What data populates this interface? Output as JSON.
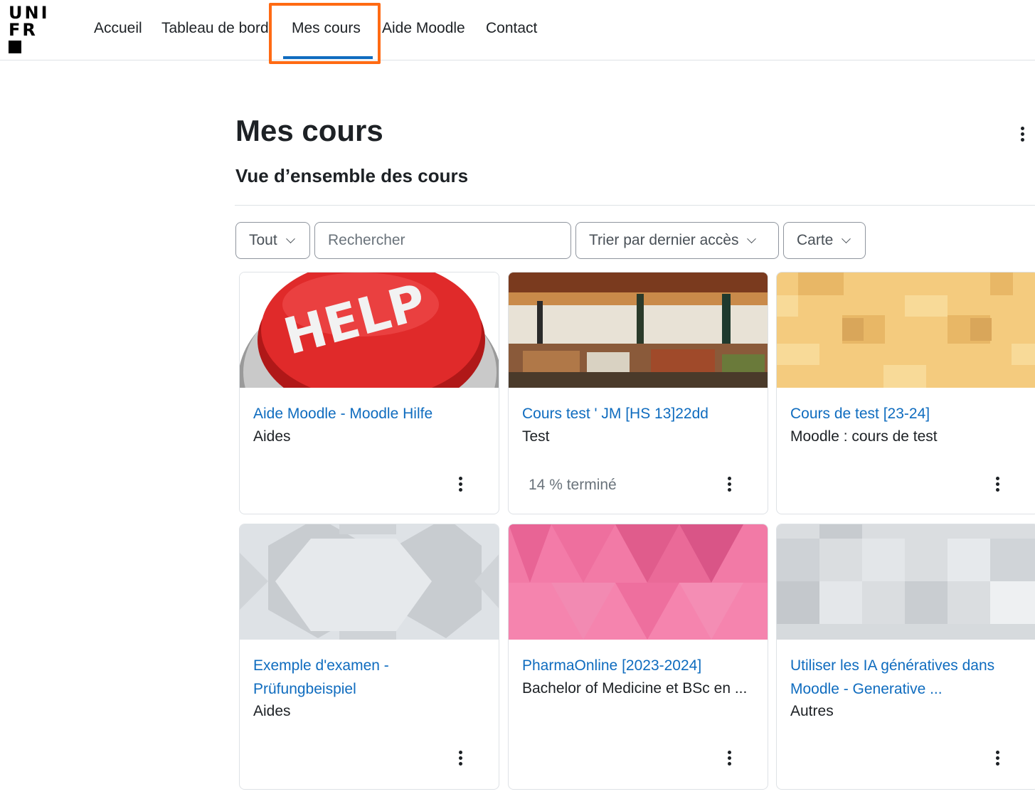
{
  "logo": {
    "line1": "UNI",
    "line2": "FR"
  },
  "nav": {
    "items": [
      "Accueil",
      "Tableau de bord",
      "Mes cours",
      "Aide Moodle",
      "Contact"
    ],
    "active": "Mes cours"
  },
  "page": {
    "title": "Mes cours",
    "section_title": "Vue d’ensemble des cours"
  },
  "filters": {
    "grouping": "Tout",
    "search_placeholder": "Rechercher",
    "sort": "Trier par dernier accès",
    "view": "Carte"
  },
  "courses": [
    {
      "title": "Aide Moodle - Moodle Hilfe",
      "category": "Aides",
      "progress": "",
      "image": "help-button-photo"
    },
    {
      "title": "Cours test ' JM [HS 13]22dd",
      "category": "Test",
      "progress": "14 % terminé",
      "image": "market-photo"
    },
    {
      "title": "Cours de test [23-24]",
      "category": "Moodle : cours de test",
      "progress": "",
      "image": "yellow-pattern"
    },
    {
      "title_line1": "Exemple d'examen -",
      "title_line2": "Prüfungbeispiel",
      "category": "Aides",
      "progress": "",
      "image": "grey-octagon-pattern"
    },
    {
      "title": "PharmaOnline [2023-2024]",
      "category": "Bachelor of Medicine et BSc en ...",
      "progress": "",
      "image": "pink-triangle-pattern"
    },
    {
      "title_line1": "Utiliser les IA génératives dans",
      "title_line2": "Moodle - Generative ...",
      "category": "Autres",
      "progress": "",
      "image": "grey-square-pattern"
    }
  ],
  "colors": {
    "link": "#0f6cbf",
    "highlight": "#ff6a13"
  }
}
